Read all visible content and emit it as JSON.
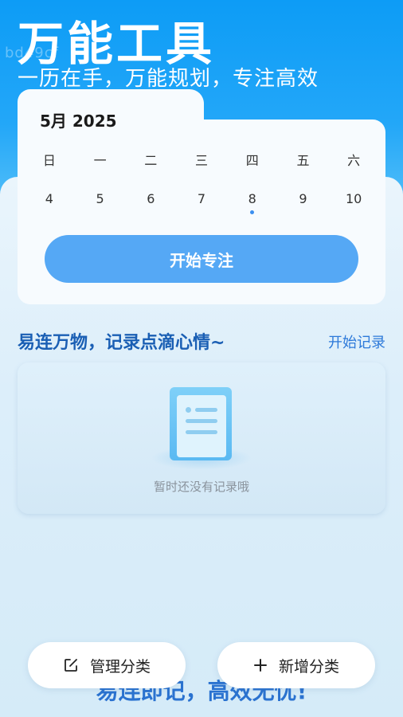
{
  "header": {
    "watermark": "bd49cf",
    "title": "万能工具",
    "subtitle": "一历在手，万能规划，专注高效"
  },
  "calendar": {
    "month_label": "5月  2025",
    "weekdays": [
      "日",
      "一",
      "二",
      "三",
      "四",
      "五",
      "六"
    ],
    "days": [
      "4",
      "5",
      "6",
      "7",
      "8",
      "9",
      "10"
    ],
    "marked_day": "8",
    "start_focus_label": "开始专注"
  },
  "records": {
    "section_title": "易连万物，记录点滴心情~",
    "start_record_label": "开始记录",
    "empty_text": "暂时还没有记录哦"
  },
  "footer": {
    "slogan": "易连即记，高效无忧!",
    "manage_label": "管理分类",
    "add_label": "新增分类",
    "manage_icon": "edit-icon",
    "add_icon": "plus-icon"
  },
  "colors": {
    "header_blue": "#0d9cf6",
    "accent_blue": "#55a8f5",
    "title_blue": "#1a5fb4"
  }
}
